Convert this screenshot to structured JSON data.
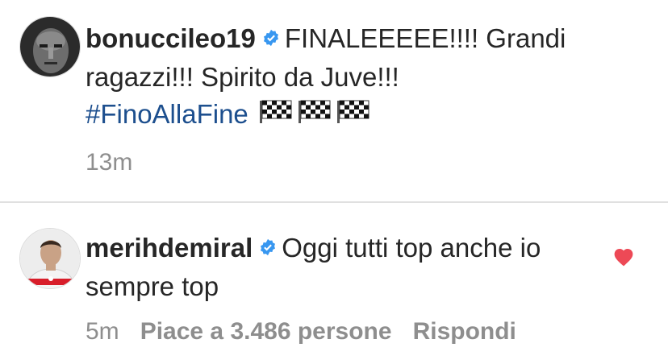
{
  "comments": [
    {
      "username": "bonuccileo19",
      "text": "FINALEEEEE!!!! Grandi ragazzi!!! Spirito da Juve!!!",
      "hashtag": "#FinoAllaFine",
      "flags_icon": "chequered-flag-icon",
      "time": "13m"
    },
    {
      "username": "merihdemiral",
      "text": "Oggi tutti top anche io sempre top",
      "time": "5m",
      "likes_label": "Piace a 3.486 persone",
      "reply_label": "Rispondi",
      "liked": true
    }
  ],
  "colors": {
    "text": "#262626",
    "meta": "#8e8e8e",
    "hashtag": "#1d4f8e",
    "verified": "#3897f0",
    "heart": "#ed4956"
  }
}
